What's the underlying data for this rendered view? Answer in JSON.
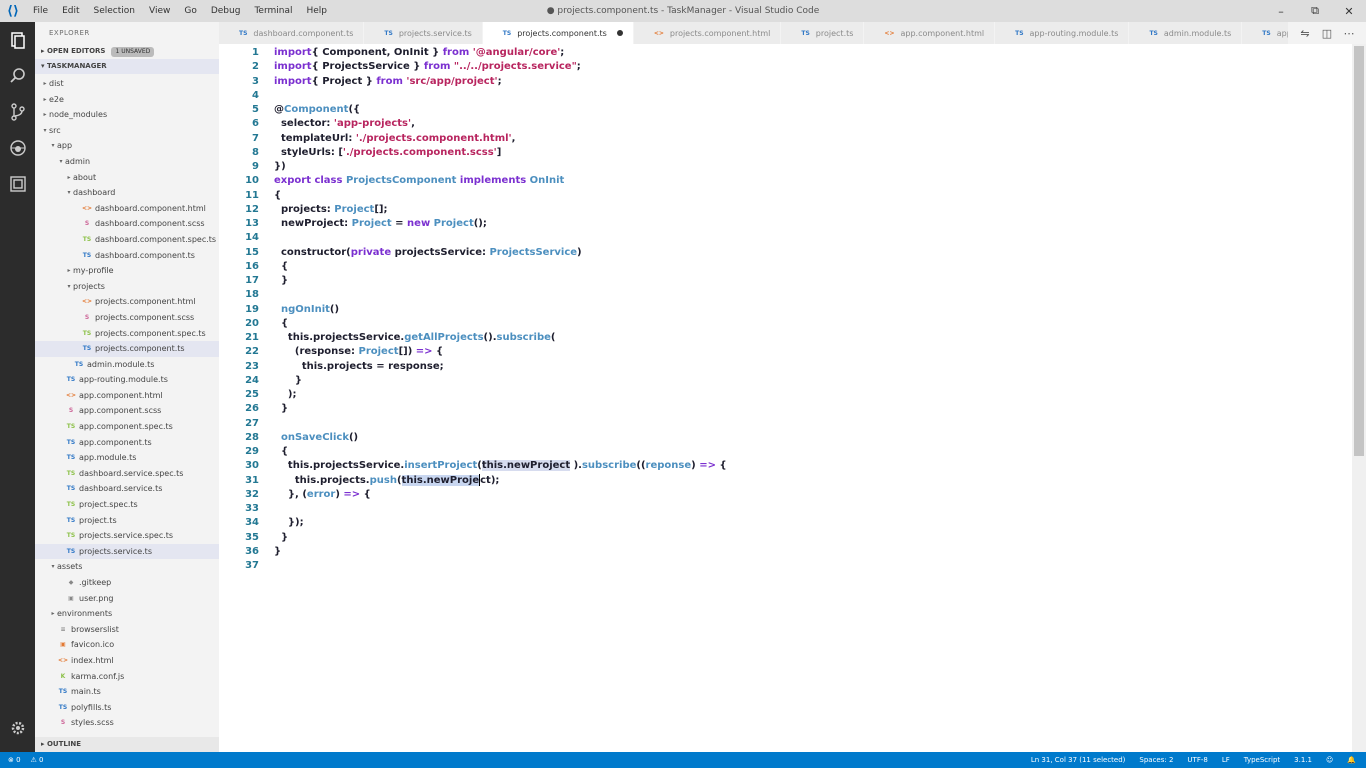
{
  "window": {
    "title": "● projects.component.ts - TaskManager - Visual Studio Code",
    "controls": [
      "–",
      "⧉",
      "✕"
    ]
  },
  "menu": [
    "File",
    "Edit",
    "Selection",
    "View",
    "Go",
    "Debug",
    "Terminal",
    "Help"
  ],
  "activity": [
    "explorer-icon",
    "search-icon",
    "source-control-icon",
    "debug-icon",
    "extensions-icon",
    "settings-gear-icon"
  ],
  "sidebar": {
    "title": "EXPLORER",
    "open_editors": "OPEN EDITORS",
    "open_editors_badge": "1 UNSAVED",
    "project": "TASKMANAGER",
    "outline": "OUTLINE",
    "tree": [
      {
        "label": "dist",
        "depth": 1,
        "twisty": "▸",
        "icon": "",
        "kind": "folder"
      },
      {
        "label": "e2e",
        "depth": 1,
        "twisty": "▸",
        "icon": "",
        "kind": "folder"
      },
      {
        "label": "node_modules",
        "depth": 1,
        "twisty": "▸",
        "icon": "",
        "kind": "folder"
      },
      {
        "label": "src",
        "depth": 1,
        "twisty": "▾",
        "icon": "",
        "kind": "folder"
      },
      {
        "label": "app",
        "depth": 2,
        "twisty": "▾",
        "icon": "",
        "kind": "folder"
      },
      {
        "label": "admin",
        "depth": 3,
        "twisty": "▾",
        "icon": "",
        "kind": "folder"
      },
      {
        "label": "about",
        "depth": 4,
        "twisty": "▸",
        "icon": "",
        "kind": "folder"
      },
      {
        "label": "dashboard",
        "depth": 4,
        "twisty": "▾",
        "icon": "",
        "kind": "folder"
      },
      {
        "label": "dashboard.component.html",
        "depth": 5,
        "twisty": "",
        "icon": "<>",
        "kind": "html"
      },
      {
        "label": "dashboard.component.scss",
        "depth": 5,
        "twisty": "",
        "icon": "S",
        "kind": "scss"
      },
      {
        "label": "dashboard.component.spec.ts",
        "depth": 5,
        "twisty": "",
        "icon": "TS",
        "kind": "spec"
      },
      {
        "label": "dashboard.component.ts",
        "depth": 5,
        "twisty": "",
        "icon": "TS",
        "kind": "ts"
      },
      {
        "label": "my-profile",
        "depth": 4,
        "twisty": "▸",
        "icon": "",
        "kind": "folder"
      },
      {
        "label": "projects",
        "depth": 4,
        "twisty": "▾",
        "icon": "",
        "kind": "folder"
      },
      {
        "label": "projects.component.html",
        "depth": 5,
        "twisty": "",
        "icon": "<>",
        "kind": "html"
      },
      {
        "label": "projects.component.scss",
        "depth": 5,
        "twisty": "",
        "icon": "S",
        "kind": "scss"
      },
      {
        "label": "projects.component.spec.ts",
        "depth": 5,
        "twisty": "",
        "icon": "TS",
        "kind": "spec"
      },
      {
        "label": "projects.component.ts",
        "depth": 5,
        "twisty": "",
        "icon": "TS",
        "kind": "ts",
        "selected": true
      },
      {
        "label": "admin.module.ts",
        "depth": 4,
        "twisty": "",
        "icon": "TS",
        "kind": "ts"
      },
      {
        "label": "app-routing.module.ts",
        "depth": 3,
        "twisty": "",
        "icon": "TS",
        "kind": "ts"
      },
      {
        "label": "app.component.html",
        "depth": 3,
        "twisty": "",
        "icon": "<>",
        "kind": "html"
      },
      {
        "label": "app.component.scss",
        "depth": 3,
        "twisty": "",
        "icon": "S",
        "kind": "scss"
      },
      {
        "label": "app.component.spec.ts",
        "depth": 3,
        "twisty": "",
        "icon": "TS",
        "kind": "spec"
      },
      {
        "label": "app.component.ts",
        "depth": 3,
        "twisty": "",
        "icon": "TS",
        "kind": "ts"
      },
      {
        "label": "app.module.ts",
        "depth": 3,
        "twisty": "",
        "icon": "TS",
        "kind": "ts"
      },
      {
        "label": "dashboard.service.spec.ts",
        "depth": 3,
        "twisty": "",
        "icon": "TS",
        "kind": "spec"
      },
      {
        "label": "dashboard.service.ts",
        "depth": 3,
        "twisty": "",
        "icon": "TS",
        "kind": "ts"
      },
      {
        "label": "project.spec.ts",
        "depth": 3,
        "twisty": "",
        "icon": "TS",
        "kind": "spec"
      },
      {
        "label": "project.ts",
        "depth": 3,
        "twisty": "",
        "icon": "TS",
        "kind": "ts"
      },
      {
        "label": "projects.service.spec.ts",
        "depth": 3,
        "twisty": "",
        "icon": "TS",
        "kind": "spec"
      },
      {
        "label": "projects.service.ts",
        "depth": 3,
        "twisty": "",
        "icon": "TS",
        "kind": "ts",
        "selected": true
      },
      {
        "label": "assets",
        "depth": 2,
        "twisty": "▾",
        "icon": "",
        "kind": "folder"
      },
      {
        "label": ".gitkeep",
        "depth": 3,
        "twisty": "",
        "icon": "◆",
        "kind": "gen"
      },
      {
        "label": "user.png",
        "depth": 3,
        "twisty": "",
        "icon": "▣",
        "kind": "gen"
      },
      {
        "label": "environments",
        "depth": 2,
        "twisty": "▸",
        "icon": "",
        "kind": "folder"
      },
      {
        "label": "browserslist",
        "depth": 2,
        "twisty": "",
        "icon": "≡",
        "kind": "gen"
      },
      {
        "label": "favicon.ico",
        "depth": 2,
        "twisty": "",
        "icon": "▣",
        "kind": "html"
      },
      {
        "label": "index.html",
        "depth": 2,
        "twisty": "",
        "icon": "<>",
        "kind": "html"
      },
      {
        "label": "karma.conf.js",
        "depth": 2,
        "twisty": "",
        "icon": "K",
        "kind": "spec"
      },
      {
        "label": "main.ts",
        "depth": 2,
        "twisty": "",
        "icon": "TS",
        "kind": "ts"
      },
      {
        "label": "polyfills.ts",
        "depth": 2,
        "twisty": "",
        "icon": "TS",
        "kind": "ts"
      },
      {
        "label": "styles.scss",
        "depth": 2,
        "twisty": "",
        "icon": "S",
        "kind": "scss"
      }
    ]
  },
  "tabs": [
    {
      "label": "dashboard.component.ts",
      "icon": "TS",
      "kind": "ts"
    },
    {
      "label": "projects.service.ts",
      "icon": "TS",
      "kind": "ts"
    },
    {
      "label": "projects.component.ts",
      "icon": "TS",
      "kind": "ts",
      "active": true,
      "dirty": true
    },
    {
      "label": "projects.component.html",
      "icon": "<>",
      "kind": "html"
    },
    {
      "label": "project.ts",
      "icon": "TS",
      "kind": "ts"
    },
    {
      "label": "app.component.html",
      "icon": "<>",
      "kind": "html"
    },
    {
      "label": "app-routing.module.ts",
      "icon": "TS",
      "kind": "ts"
    },
    {
      "label": "admin.module.ts",
      "icon": "TS",
      "kind": "ts"
    },
    {
      "label": "app.module.ts",
      "icon": "TS",
      "kind": "ts"
    }
  ],
  "tab_actions": [
    "compare-icon",
    "split-editor-icon",
    "more-icon"
  ],
  "editor": {
    "lines": [
      [
        [
          "k",
          "import"
        ],
        [
          "",
          "{ Component, OnInit } "
        ],
        [
          "k",
          "from"
        ],
        [
          "s",
          " '@angular/core'"
        ],
        [
          "",
          ";"
        ]
      ],
      [
        [
          "k",
          "import"
        ],
        [
          "",
          "{ ProjectsService } "
        ],
        [
          "k",
          "from"
        ],
        [
          "s",
          " \"../../projects.service\""
        ],
        [
          "",
          ";"
        ]
      ],
      [
        [
          "k",
          "import"
        ],
        [
          "",
          "{ Project } "
        ],
        [
          "k",
          "from"
        ],
        [
          "s",
          " 'src/app/project'"
        ],
        [
          "",
          ";"
        ]
      ],
      [],
      [
        [
          "",
          "@"
        ],
        [
          "f",
          "Component"
        ],
        [
          "",
          "({"
        ]
      ],
      [
        [
          "",
          "  selector: "
        ],
        [
          "s",
          "'app-projects'"
        ],
        [
          "",
          ","
        ]
      ],
      [
        [
          "",
          "  templateUrl: "
        ],
        [
          "s",
          "'./projects.component.html'"
        ],
        [
          "",
          ","
        ]
      ],
      [
        [
          "",
          "  styleUrls: ["
        ],
        [
          "s",
          "'./projects.component.scss'"
        ],
        [
          "",
          "]"
        ]
      ],
      [
        [
          "",
          "})"
        ]
      ],
      [
        [
          "k",
          "export class "
        ],
        [
          "t",
          "ProjectsComponent "
        ],
        [
          "k",
          "implements "
        ],
        [
          "t",
          "OnInit"
        ]
      ],
      [
        [
          "",
          "{"
        ]
      ],
      [
        [
          "",
          "  projects: "
        ],
        [
          "t",
          "Project"
        ],
        [
          "",
          "[];"
        ]
      ],
      [
        [
          "",
          "  newProject: "
        ],
        [
          "t",
          "Project"
        ],
        [
          "",
          " = "
        ],
        [
          "k",
          "new "
        ],
        [
          "t",
          "Project"
        ],
        [
          "",
          "();"
        ]
      ],
      [],
      [
        [
          "",
          "  constructor("
        ],
        [
          "k",
          "private "
        ],
        [
          "",
          "projectsService: "
        ],
        [
          "t",
          "ProjectsService"
        ],
        [
          "",
          ")"
        ]
      ],
      [
        [
          "",
          "  {"
        ]
      ],
      [
        [
          "",
          "  }"
        ]
      ],
      [],
      [
        [
          "",
          "  "
        ],
        [
          "f",
          "ngOnInit"
        ],
        [
          "",
          "()"
        ]
      ],
      [
        [
          "",
          "  {"
        ]
      ],
      [
        [
          "",
          "    this.projectsService."
        ],
        [
          "f",
          "getAllProjects"
        ],
        [
          "",
          "()."
        ],
        [
          "f",
          "subscribe"
        ],
        [
          "",
          "("
        ]
      ],
      [
        [
          "",
          "      (response: "
        ],
        [
          "t",
          "Project"
        ],
        [
          "",
          "[]) "
        ],
        [
          "k",
          "=>"
        ],
        [
          "",
          " {"
        ]
      ],
      [
        [
          "",
          "        this.projects = response;"
        ]
      ],
      [
        [
          "",
          "      }"
        ]
      ],
      [
        [
          "",
          "    );"
        ]
      ],
      [
        [
          "",
          "  }"
        ]
      ],
      [],
      [
        [
          "",
          "  "
        ],
        [
          "f",
          "onSaveClick"
        ],
        [
          "",
          "()"
        ]
      ],
      [
        [
          "",
          "  {"
        ]
      ],
      [
        [
          "",
          "    this.projectsService."
        ],
        [
          "f",
          "insertProject"
        ],
        [
          "",
          "("
        ],
        [
          "word",
          "this.newProject"
        ],
        [
          "",
          " )."
        ],
        [
          "f",
          "subscribe"
        ],
        [
          "",
          "(("
        ],
        [
          "t",
          "reponse"
        ],
        [
          "",
          ") "
        ],
        [
          "k",
          "=>"
        ],
        [
          "",
          " {"
        ]
      ],
      [
        [
          "",
          "      this.projects."
        ],
        [
          "f",
          "push"
        ],
        [
          "",
          "("
        ],
        [
          "sel",
          "this.newProje"
        ],
        [
          "cursor",
          ""
        ],
        [
          "",
          "ct);"
        ]
      ],
      [
        [
          "",
          "    }, ("
        ],
        [
          "t",
          "error"
        ],
        [
          "",
          ") "
        ],
        [
          "k",
          "=>"
        ],
        [
          "",
          " {"
        ]
      ],
      [],
      [
        [
          "",
          "    });"
        ]
      ],
      [
        [
          "",
          "  }"
        ]
      ],
      [
        [
          "",
          "}"
        ]
      ],
      []
    ]
  },
  "status": {
    "left": [
      "⊗ 0",
      "⚠ 0"
    ],
    "right": [
      "Ln 31, Col 37 (11 selected)",
      "Spaces: 2",
      "UTF-8",
      "LF",
      "TypeScript",
      "3.1.1",
      "☺",
      "🔔"
    ]
  }
}
